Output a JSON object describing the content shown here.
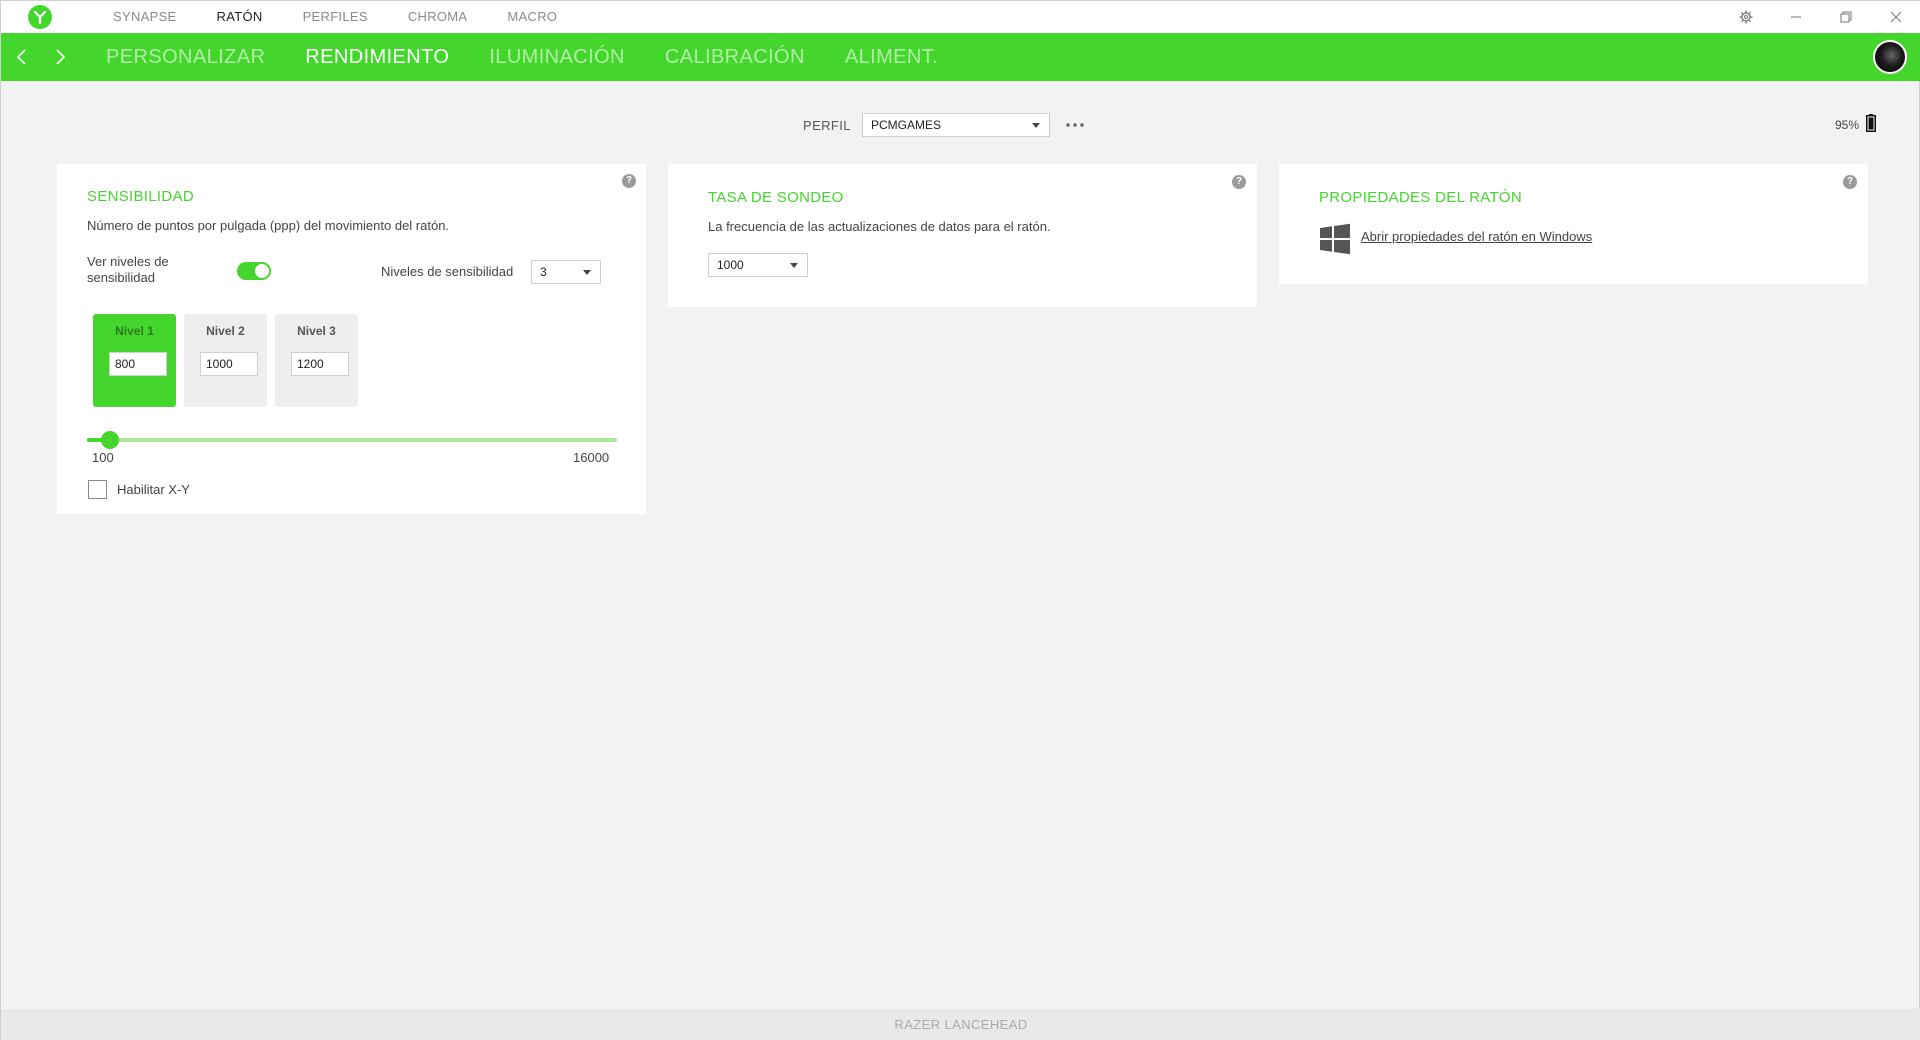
{
  "topnav": {
    "items": [
      {
        "label": "SYNAPSE",
        "active": false
      },
      {
        "label": "RATÓN",
        "active": true
      },
      {
        "label": "PERFILES",
        "active": false
      },
      {
        "label": "CHROMA",
        "active": false
      },
      {
        "label": "MACRO",
        "active": false
      }
    ]
  },
  "subnav": {
    "tabs": [
      {
        "label": "PERSONALIZAR",
        "active": false
      },
      {
        "label": "RENDIMIENTO",
        "active": true
      },
      {
        "label": "ILUMINACIÓN",
        "active": false
      },
      {
        "label": "CALIBRACIÓN",
        "active": false
      },
      {
        "label": "ALIMENT.",
        "active": false
      }
    ]
  },
  "profile": {
    "label": "PERFIL",
    "selected": "PCMGAMES",
    "battery": "95%"
  },
  "sensitivity": {
    "title": "SENSIBILIDAD",
    "description": "Número de puntos por pulgada (ppp) del movimiento del ratón.",
    "toggle_label": "Ver niveles de sensibilidad",
    "toggle_on": true,
    "levels_label": "Niveles de sensibilidad",
    "levels_count": "3",
    "levels": [
      {
        "name": "Nivel 1",
        "value": "800",
        "active": true
      },
      {
        "name": "Nivel 2",
        "value": "1000",
        "active": false
      },
      {
        "name": "Nivel 3",
        "value": "1200",
        "active": false
      }
    ],
    "slider": {
      "min": "100",
      "max": "16000",
      "value": 800
    },
    "xy_label": "Habilitar X-Y",
    "xy_checked": false
  },
  "polling": {
    "title": "TASA DE SONDEO",
    "description": "La frecuencia de las actualizaciones de datos para el ratón.",
    "selected": "1000"
  },
  "mouse_properties": {
    "title": "PROPIEDADES DEL RATÓN",
    "link": "Abrir propiedades del ratón en Windows"
  },
  "help_symbol": "?",
  "status": {
    "device": "RAZER LANCEHEAD"
  },
  "colors": {
    "accent": "#44d62c",
    "background": "#f2f2f2"
  }
}
